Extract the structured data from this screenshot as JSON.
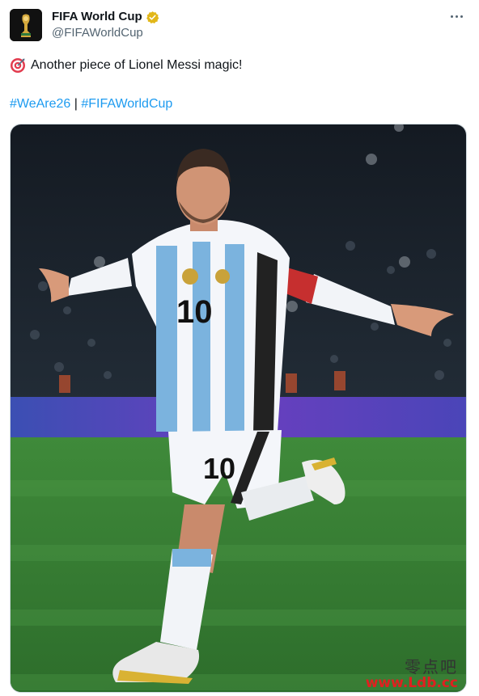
{
  "account": {
    "display_name": "FIFA World Cup",
    "handle": "@FIFAWorldCup"
  },
  "tweet": {
    "text": "Another piece of Lionel Messi magic!",
    "leading_icon": "direct-hit-icon",
    "hashtags": [
      "#WeAre26",
      "#FIFAWorldCup"
    ],
    "separator": "|"
  },
  "media": {
    "jersey_number": "10",
    "shorts_number": "10"
  },
  "watermark": {
    "line1": "零点吧",
    "line2": "www.Ldb.cc"
  },
  "colors": {
    "link": "#1d9bf0",
    "verified": "#e2b719",
    "secondary_text": "#536471"
  }
}
